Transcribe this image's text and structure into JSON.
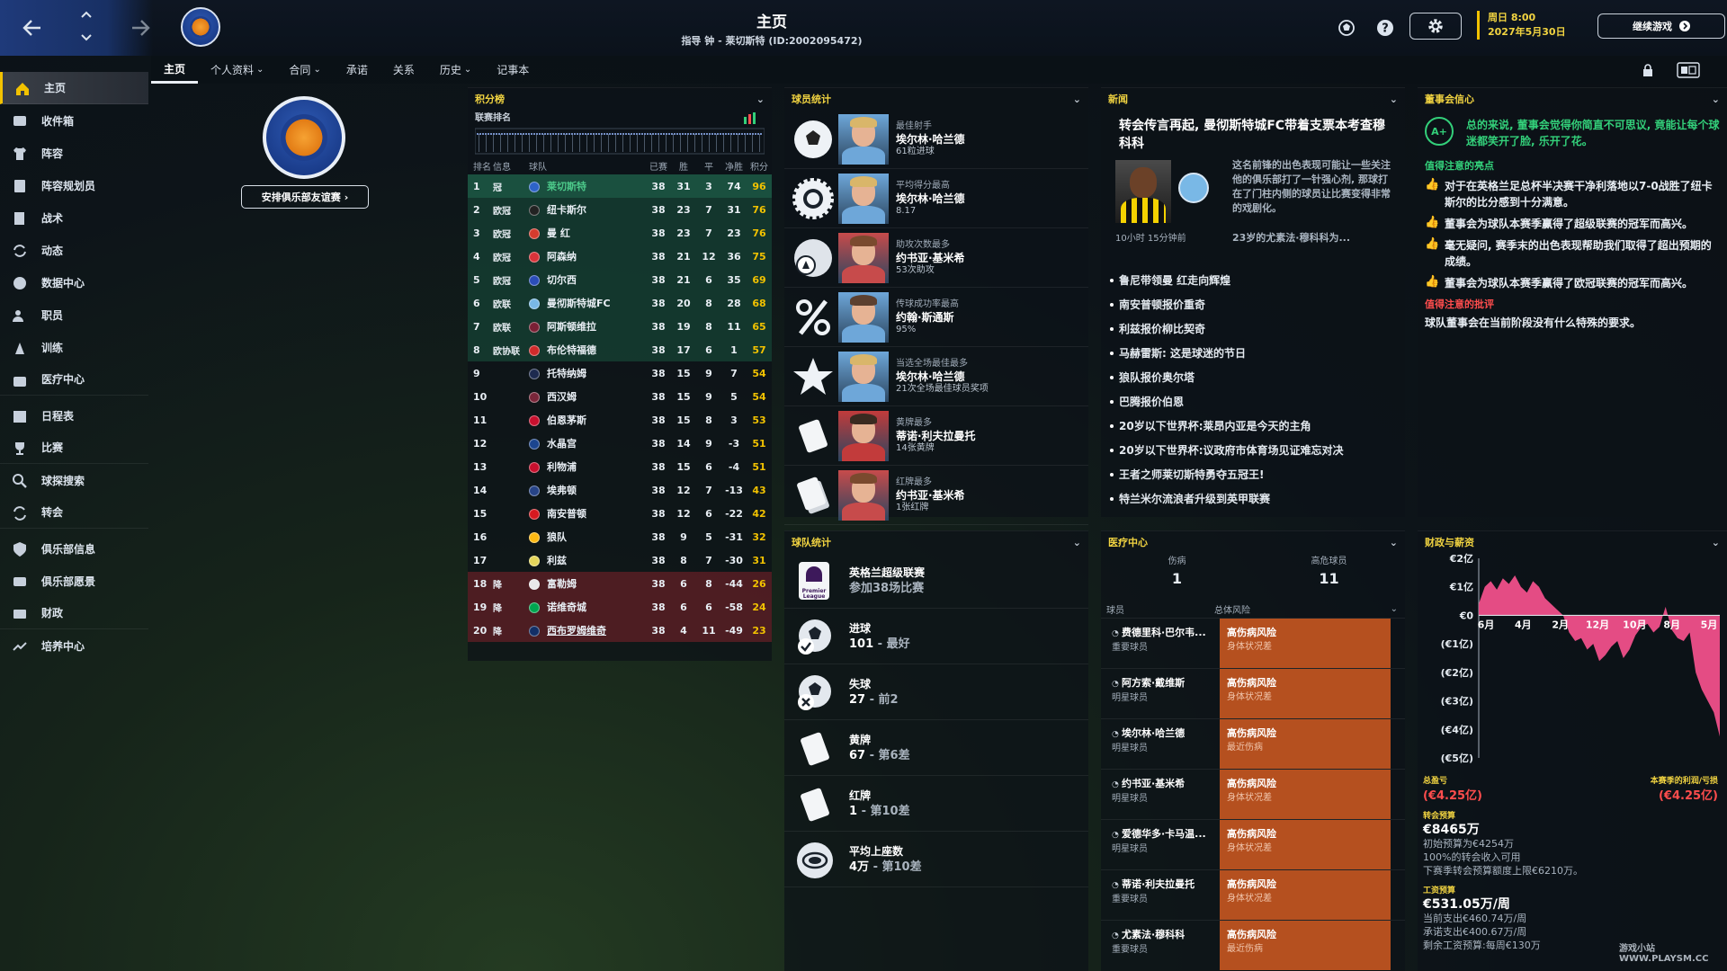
{
  "header": {
    "title": "主页",
    "subtitle": "指导 钟 - 莱切斯特 (ID:2002095472)",
    "date_line1": "周日 8:00",
    "date_line2": "2027年5月30日",
    "continue_label": "继续游戏"
  },
  "tabs": [
    {
      "label": "主页",
      "active": true
    },
    {
      "label": "个人资料",
      "dropdown": true
    },
    {
      "label": "合同",
      "dropdown": true
    },
    {
      "label": "承诺"
    },
    {
      "label": "关系"
    },
    {
      "label": "历史",
      "dropdown": true
    },
    {
      "label": "记事本"
    }
  ],
  "sidebar": {
    "items": [
      {
        "label": "主页",
        "icon": "home-icon",
        "active": true
      },
      {
        "label": "收件箱",
        "icon": "inbox-icon"
      },
      {
        "label": "阵容",
        "icon": "shirt-icon"
      },
      {
        "label": "阵容规划员",
        "icon": "clipboard-icon"
      },
      {
        "label": "战术",
        "icon": "tactics-board-icon"
      },
      {
        "label": "动态",
        "icon": "dynamics-icon"
      },
      {
        "label": "数据中心",
        "icon": "data-hub-icon"
      },
      {
        "label": "职员",
        "icon": "staff-icon"
      },
      {
        "label": "训练",
        "icon": "training-icon"
      },
      {
        "label": "医疗中心",
        "icon": "medical-kit-icon"
      },
      {
        "label": "日程表",
        "icon": "calendar-icon"
      },
      {
        "label": "比赛",
        "icon": "trophy-icon"
      },
      {
        "label": "球探搜索",
        "icon": "scout-search-icon"
      },
      {
        "label": "转会",
        "icon": "transfer-icon"
      },
      {
        "label": "俱乐部信息",
        "icon": "shield-icon"
      },
      {
        "label": "俱乐部愿景",
        "icon": "vision-icon"
      },
      {
        "label": "财政",
        "icon": "finance-icon"
      },
      {
        "label": "培养中心",
        "icon": "development-icon"
      }
    ]
  },
  "club": {
    "friendly_label": "安排俱乐部友谊赛"
  },
  "standings": {
    "title": "积分榜",
    "sub": "联赛排名",
    "headers": [
      "排名",
      "信息",
      "球队",
      "已赛",
      "胜",
      "平",
      "净胜",
      "积分"
    ],
    "rows": [
      {
        "pos": "1",
        "info": "冠",
        "team": "莱切斯特",
        "p": "38",
        "w": "31",
        "d": "3",
        "gd": "74",
        "pts": "96",
        "zone": "first",
        "c": "#2e63c8"
      },
      {
        "pos": "2",
        "info": "欧冠",
        "team": "纽卡斯尔",
        "p": "38",
        "w": "23",
        "d": "7",
        "gd": "31",
        "pts": "76",
        "zone": "top",
        "c": "#222222"
      },
      {
        "pos": "3",
        "info": "欧冠",
        "team": "曼 红",
        "p": "38",
        "w": "23",
        "d": "7",
        "gd": "23",
        "pts": "76",
        "zone": "top",
        "c": "#d63b2e"
      },
      {
        "pos": "4",
        "info": "欧冠",
        "team": "阿森纳",
        "p": "38",
        "w": "21",
        "d": "12",
        "gd": "36",
        "pts": "75",
        "zone": "top",
        "c": "#d9333a"
      },
      {
        "pos": "5",
        "info": "欧冠",
        "team": "切尔西",
        "p": "38",
        "w": "21",
        "d": "6",
        "gd": "35",
        "pts": "69",
        "zone": "top",
        "c": "#2b4db8"
      },
      {
        "pos": "6",
        "info": "欧联",
        "team": "曼彻斯特城FC",
        "p": "38",
        "w": "20",
        "d": "8",
        "gd": "28",
        "pts": "68",
        "zone": "top",
        "c": "#79b8e6"
      },
      {
        "pos": "7",
        "info": "欧联",
        "team": "阿斯顿维拉",
        "p": "38",
        "w": "19",
        "d": "8",
        "gd": "11",
        "pts": "65",
        "zone": "top",
        "c": "#7a2035"
      },
      {
        "pos": "8",
        "info": "欧协联",
        "team": "布伦特福德",
        "p": "38",
        "w": "17",
        "d": "6",
        "gd": "1",
        "pts": "57",
        "zone": "top",
        "c": "#d02b2b"
      },
      {
        "pos": "9",
        "info": "",
        "team": "托特纳姆",
        "p": "38",
        "w": "15",
        "d": "9",
        "gd": "7",
        "pts": "54",
        "zone": "",
        "c": "#1d2a4f"
      },
      {
        "pos": "10",
        "info": "",
        "team": "西汉姆",
        "p": "38",
        "w": "15",
        "d": "9",
        "gd": "5",
        "pts": "54",
        "zone": "",
        "c": "#7a263a"
      },
      {
        "pos": "11",
        "info": "",
        "team": "伯恩茅斯",
        "p": "38",
        "w": "15",
        "d": "8",
        "gd": "3",
        "pts": "53",
        "zone": "",
        "c": "#c8102e"
      },
      {
        "pos": "12",
        "info": "",
        "team": "水晶宫",
        "p": "38",
        "w": "14",
        "d": "9",
        "gd": "-3",
        "pts": "51",
        "zone": "",
        "c": "#1b458f"
      },
      {
        "pos": "13",
        "info": "",
        "team": "利物浦",
        "p": "38",
        "w": "15",
        "d": "6",
        "gd": "-4",
        "pts": "51",
        "zone": "",
        "c": "#c8102e"
      },
      {
        "pos": "14",
        "info": "",
        "team": "埃弗顿",
        "p": "38",
        "w": "12",
        "d": "7",
        "gd": "-13",
        "pts": "43",
        "zone": "",
        "c": "#274488"
      },
      {
        "pos": "15",
        "info": "",
        "team": "南安普顿",
        "p": "38",
        "w": "12",
        "d": "6",
        "gd": "-22",
        "pts": "42",
        "zone": "",
        "c": "#d71920"
      },
      {
        "pos": "16",
        "info": "",
        "team": "狼队",
        "p": "38",
        "w": "9",
        "d": "5",
        "gd": "-31",
        "pts": "32",
        "zone": "",
        "c": "#fdb913"
      },
      {
        "pos": "17",
        "info": "",
        "team": "利兹",
        "p": "38",
        "w": "8",
        "d": "7",
        "gd": "-30",
        "pts": "31",
        "zone": "",
        "c": "#e5d65b"
      },
      {
        "pos": "18",
        "info": "降",
        "team": "富勒姆",
        "p": "38",
        "w": "6",
        "d": "8",
        "gd": "-44",
        "pts": "26",
        "zone": "rel",
        "c": "#e8e8e8"
      },
      {
        "pos": "19",
        "info": "降",
        "team": "诺维奇城",
        "p": "38",
        "w": "6",
        "d": "6",
        "gd": "-58",
        "pts": "24",
        "zone": "rel",
        "c": "#00a650"
      },
      {
        "pos": "20",
        "info": "降",
        "team": "西布罗姆维奇",
        "p": "38",
        "w": "4",
        "d": "11",
        "gd": "-49",
        "pts": "23",
        "zone": "rel",
        "c": "#122f67"
      }
    ]
  },
  "player_stats": {
    "title": "球员统计",
    "rows": [
      {
        "icon": "football-icon",
        "label": "最佳射手",
        "name": "埃尔林·哈兰德",
        "value": "61粒进球",
        "face": "#6ea7d9",
        "hair": "#d9b66a"
      },
      {
        "icon": "rating-badge-icon",
        "label": "平均得分最高",
        "name": "埃尔林·哈兰德",
        "value": "8.17",
        "face": "#6ea7d9",
        "hair": "#d9b66a"
      },
      {
        "icon": "assist-ball-icon",
        "label": "助攻次数最多",
        "name": "约书亚·基米希",
        "value": "53次助攻",
        "face": "#c74b4b",
        "hair": "#7a4a2e"
      },
      {
        "icon": "percent-icon",
        "label": "传球成功率最高",
        "name": "约翰·斯通斯",
        "value": "95%",
        "face": "#6ea7d9",
        "hair": "#5c4030"
      },
      {
        "icon": "star-icon",
        "label": "当选全场最佳最多",
        "name": "埃尔林·哈兰德",
        "value": "21次全场最佳球员奖项",
        "face": "#6ea7d9",
        "hair": "#d9b66a"
      },
      {
        "icon": "yellow-card-icon",
        "label": "黄牌最多",
        "name": "蒂诺·利夫拉曼托",
        "value": "14张黄牌",
        "face": "#c23b3b",
        "hair": "#3a2a20"
      },
      {
        "icon": "red-card-icon",
        "label": "红牌最多",
        "name": "约书亚·基米希",
        "value": "1张红牌",
        "face": "#c74b4b",
        "hair": "#7a4a2e"
      }
    ]
  },
  "team_stats": {
    "title": "球队统计",
    "rows": [
      {
        "icon": "premier-league-icon",
        "a": "英格兰超级联赛",
        "b": "参加38场比赛",
        "b2": ""
      },
      {
        "icon": "goals-scored-icon",
        "a": "进球",
        "b": "101",
        "b2": " - 最好"
      },
      {
        "icon": "goals-conceded-icon",
        "a": "失球",
        "b": "27",
        "b2": " - 前2"
      },
      {
        "icon": "yellow-card-icon",
        "a": "黄牌",
        "b": "67",
        "b2": " - 第6差"
      },
      {
        "icon": "red-card-icon",
        "a": "红牌",
        "b": "1",
        "b2": " - 第10差"
      },
      {
        "icon": "attendance-icon",
        "a": "平均上座数",
        "b": "4万",
        "b2": " - 第10差"
      }
    ]
  },
  "news": {
    "title": "新闻",
    "headline": "转会传言再起, 曼彻斯特城FC带着支票本考查穆科科",
    "body": "这名前锋的出色表现可能让一些关注他的俱乐部打了一针强心剂, 那球打在了门柱内侧的球员让比赛变得非常的戏剧化。",
    "time": "10小时 15分钟前",
    "teaser": "23岁的尤素法·穆科科为...",
    "items": [
      "鲁尼带领曼 红走向辉煌",
      "南安普顿报价重奇",
      "利兹报价柳比契奇",
      "马赫雷斯: 这是球迷的节日",
      "狼队报价奥尔塔",
      "巴腾报价伯恩",
      "20岁以下世界杯:莱昂内亚是今天的主角",
      "20岁以下世界杯:议政府市体育场见证难忘对决",
      "王者之师莱切斯特勇夺五冠王!",
      "特兰米尔流浪者升级到英甲联赛"
    ]
  },
  "board": {
    "title": "董事会信心",
    "grade": "A+",
    "summary": "总的来说, 董事会觉得你简直不可思议, 竟能让每个球迷都笑开了脸, 乐开了花。",
    "highlights_title": "值得注意的亮点",
    "highlights": [
      "对于在英格兰足总杯半决赛干净利落地以7-0战胜了纽卡斯尔的比分感到十分满意。",
      "董事会为球队本赛季赢得了超级联赛的冠军而高兴。",
      "毫无疑问, 赛季末的出色表现帮助我们取得了超出预期的成绩。",
      "董事会为球队本赛季赢得了欧冠联赛的冠军而高兴。"
    ],
    "criticism_title": "值得注意的批评",
    "criticism": "球队董事会在当前阶段没有什么特殊的要求。"
  },
  "medical": {
    "title": "医疗中心",
    "injuries_label": "伤病",
    "injuries": "1",
    "high_risk_label": "高危球员",
    "high_risk": "11",
    "col_player": "球员",
    "col_risk": "总体风险",
    "rows": [
      {
        "name": "费德里科·巴尔韦...",
        "role": "重要球员",
        "risk": "高伤病风险",
        "reason": "身体状况差"
      },
      {
        "name": "阿方索·戴维斯",
        "role": "明星球员",
        "risk": "高伤病风险",
        "reason": "身体状况差"
      },
      {
        "name": "埃尔林·哈兰德",
        "role": "明星球员",
        "risk": "高伤病风险",
        "reason": "最近伤病"
      },
      {
        "name": "约书亚·基米希",
        "role": "明星球员",
        "risk": "高伤病风险",
        "reason": "身体状况差"
      },
      {
        "name": "爱德华多·卡马温...",
        "role": "明星球员",
        "risk": "高伤病风险",
        "reason": "身体状况差"
      },
      {
        "name": "蒂诺·利夫拉曼托",
        "role": "重要球员",
        "risk": "高伤病风险",
        "reason": "身体状况差"
      },
      {
        "name": "尤素法·穆科科",
        "role": "重要球员",
        "risk": "高伤病风险",
        "reason": "最近伤病"
      }
    ]
  },
  "finance": {
    "title": "财政与薪资",
    "chart_data": {
      "type": "area",
      "yticks": [
        "€2亿",
        "€1亿",
        "€0",
        "(€1亿)",
        "(€2亿)",
        "(€3亿)",
        "(€4亿)",
        "(€5亿)"
      ],
      "ylim": [
        -5,
        2
      ],
      "xticks": [
        "6月",
        "4月",
        "2月",
        "12月",
        "10月",
        "8月",
        "5月"
      ],
      "values": [
        0.4,
        1.0,
        1.2,
        0.9,
        1.3,
        1.1,
        1.4,
        1.0,
        0.8,
        1.2,
        1.0,
        0.6,
        0.4,
        0.2,
        0.0,
        -0.6,
        -0.9,
        -0.8,
        -1.2,
        -1.0,
        -1.6,
        -1.4,
        -1.1,
        -0.9,
        -1.5,
        -1.2,
        -0.7,
        -0.4,
        -0.3,
        -0.6,
        -0.4,
        0.3,
        -0.5,
        -0.8,
        -0.9,
        -0.6,
        -2.0,
        -2.6,
        -3.0,
        -3.4,
        -4.25
      ],
      "color": "#f0508a"
    },
    "balance_label": "总盈亏",
    "balance": "(€4.25亿)",
    "season_label": "本赛季的利润/亏损",
    "season": "(€4.25亿)",
    "transfer_label": "转会预算",
    "transfer": "€8465万",
    "transfer_l1": "初始预算为€4254万",
    "transfer_l2": "100%的转会收入可用",
    "transfer_l3": "下赛季转会预算额度上限€6210万。",
    "wage_label": "工资预算",
    "wage": "€531.05万/周",
    "wage_l1": "当前支出€460.74万/周",
    "wage_l2": "承诺支出€400.67万/周",
    "wage_l3": "剩余工资预算:每周€130万"
  },
  "watermark": "游戏小站 WWW.PLAYSM.CC"
}
